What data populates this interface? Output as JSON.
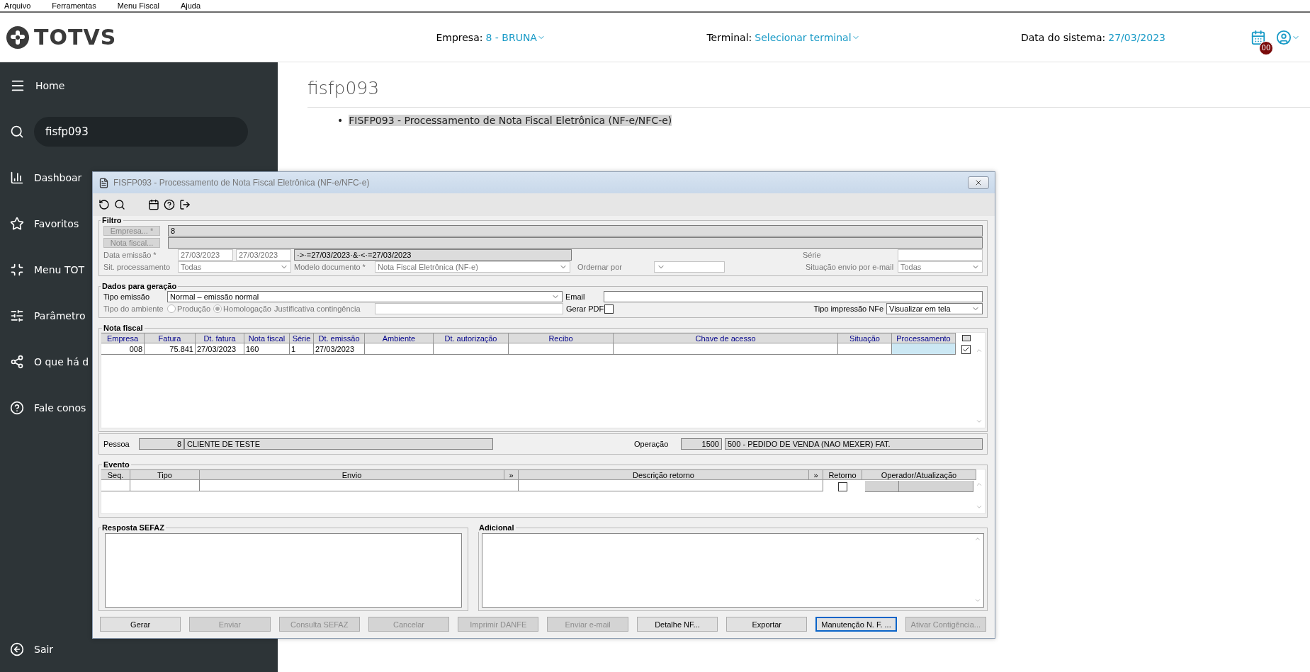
{
  "menu_bar": [
    "Arquivo",
    "Ferramentas",
    "Menu Fiscal",
    "Ajuda"
  ],
  "header": {
    "logo": "TOTVS",
    "empresa": {
      "label": "Empresa:",
      "value": "8 - BRUNA"
    },
    "terminal": {
      "label": "Terminal:",
      "value": "Selecionar terminal"
    },
    "system_date": {
      "label": "Data do sistema:",
      "value": "27/03/2023"
    },
    "notification_badge": "00"
  },
  "sidebar": {
    "menu": {
      "label": "Home"
    },
    "search": {
      "value": "fisfp093"
    },
    "items": [
      {
        "label": "Dashboar"
      },
      {
        "label": "Favoritos"
      },
      {
        "label": "Menu TOT"
      },
      {
        "label": "Parâmetro"
      },
      {
        "label": "O que há d"
      },
      {
        "label": "Fale conos"
      }
    ],
    "exit": {
      "label": "Sair"
    }
  },
  "content": {
    "title": "fisfp093",
    "bullet": "•",
    "links": [
      "FISFP093 - Processamento de Nota Fiscal Eletrônica (NF-e/NFC-e)"
    ]
  },
  "dialog": {
    "title": "FISFP093 - Processamento de Nota Fiscal Eletrônica (NF-e/NFC-e)",
    "filtro": {
      "legend": "Filtro",
      "empresa_button": "Empresa... *",
      "empresa_value": "8",
      "nota_button": "Nota fiscal...",
      "data_label": "Data emissão *",
      "date_from": "27/03/2023",
      "date_to": "27/03/2023",
      "date_expr": "·>·=27/03/2023·&·<·=27/03/2023",
      "serie_label": "Série",
      "sit_label": "Sit. processamento",
      "sit_value": "Todas",
      "modelo_label": "Modelo documento *",
      "modelo_value": "Nota Fiscal Eletrônica (NF-e)",
      "ordenar_label": "Ordernar por",
      "envio_label": "Situação envio por e-mail",
      "envio_value": "Todas"
    },
    "dados": {
      "legend": "Dados para geração",
      "tipo_emissao_label": "Tipo emissão",
      "tipo_emissao_value": "Normal – emissão normal",
      "ambiente_label": "Tipo do ambiente",
      "ambientes": [
        {
          "label": "Produção",
          "selected": false
        },
        {
          "label": "Homologação",
          "selected": true
        }
      ],
      "justificativa_label": "Justificativa contingência",
      "email_label": "Email",
      "gerar_pdf": {
        "label": "Gerar PDF",
        "checked": false
      },
      "tipo_impressao_label": "Tipo impressão NFe",
      "tipo_impressao_value": "Visualizar em tela"
    },
    "nota_fiscal": {
      "legend": "Nota fiscal",
      "columns": [
        "Empresa",
        "Fatura",
        "Dt. fatura",
        "Nota fiscal",
        "Série",
        "Dt. emissão",
        "Ambiente",
        "Dt. autorização",
        "Recibo",
        "Chave de acesso",
        "Situação",
        "Processamento"
      ],
      "rows": [
        {
          "checked": true,
          "cells": [
            {
              "text": "008",
              "selected": false
            },
            {
              "text": "75.841",
              "selected": false
            },
            {
              "text": "27/03/2023",
              "selected": false
            },
            {
              "text": "160",
              "selected": false
            },
            {
              "text": "1",
              "selected": false
            },
            {
              "text": "27/03/2023",
              "selected": false
            },
            {
              "selected": false
            },
            {
              "selected": false
            },
            {
              "selected": false
            },
            {
              "selected": false
            },
            {
              "selected": false
            },
            {
              "selected": true
            }
          ]
        }
      ]
    },
    "pessoa": {
      "label": "Pessoa",
      "code": "8",
      "name": "CLIENTE DE TESTE",
      "operacao_label": "Operação",
      "operacao_code": "1500",
      "operacao_desc": "500 - PEDIDO DE VENDA (NAO MEXER) FAT."
    },
    "evento": {
      "legend": "Evento",
      "columns": [
        "Seq.",
        "Tipo",
        "Envio",
        "»",
        "Descrição retorno",
        "»",
        "Retorno",
        "Operador/Atualização"
      ],
      "rows": [
        {
          "retorno": false
        }
      ]
    },
    "resposta_legend": "Resposta SEFAZ",
    "adicional_legend": "Adicional",
    "buttons": [
      {
        "label": "Gerar",
        "disabled": false,
        "focused": false
      },
      {
        "label": "Enviar",
        "disabled": true,
        "focused": false
      },
      {
        "label": "Consulta SEFAZ",
        "disabled": true,
        "focused": false
      },
      {
        "label": "Cancelar",
        "disabled": true,
        "focused": false
      },
      {
        "label": "Imprimir DANFE",
        "disabled": true,
        "focused": false
      },
      {
        "label": "Enviar e-mail",
        "disabled": true,
        "focused": false
      },
      {
        "label": "Detalhe NF...",
        "disabled": false,
        "focused": false
      },
      {
        "label": "Exportar",
        "disabled": false,
        "focused": false
      },
      {
        "label": "Manutenção N. F. ...",
        "disabled": false,
        "focused": true
      },
      {
        "label": "Ativar Contigência...",
        "disabled": true,
        "focused": false
      }
    ]
  }
}
